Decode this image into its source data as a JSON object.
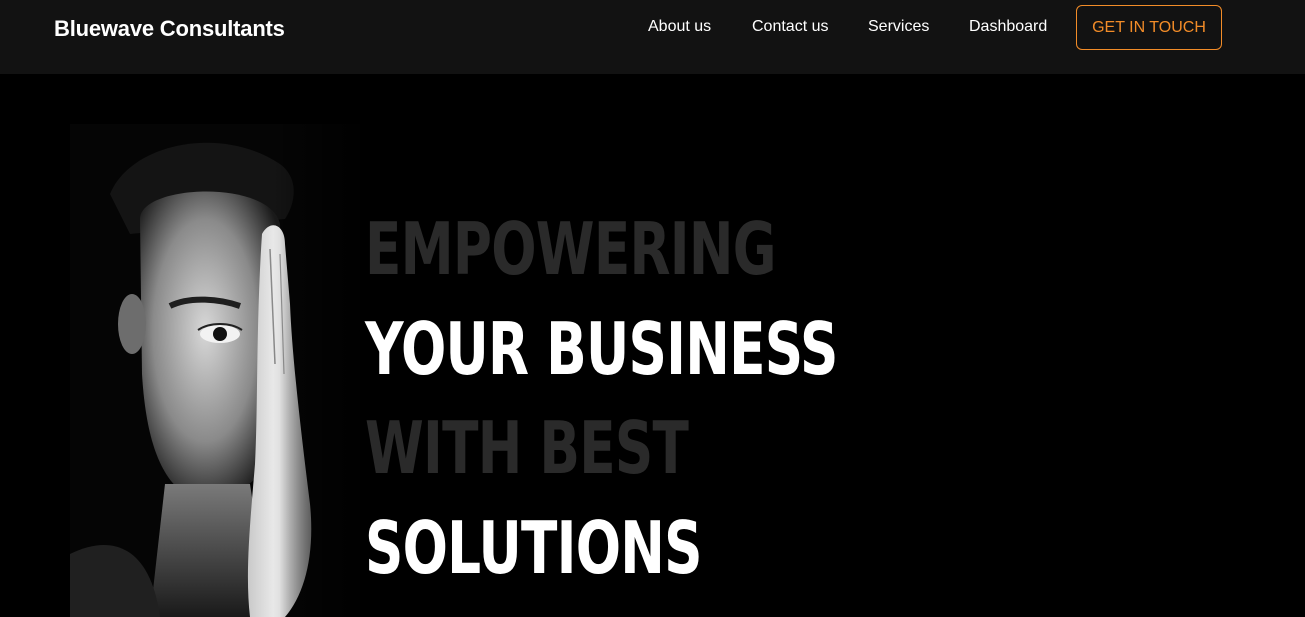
{
  "header": {
    "brand": "Bluewave Consultants",
    "nav": [
      "About us",
      "Contact us",
      "Services",
      "Dashboard"
    ],
    "cta_label": "GET IN TOUCH",
    "cta_color": "#f28c28",
    "background": "#121212"
  },
  "hero": {
    "headline_lines": [
      "EMPOWERING",
      "YOUR BUSINESS",
      "WITH BEST",
      "SOLUTIONS"
    ],
    "dim_color": "#2a2a2a",
    "bright_color": "#ffffff",
    "photo": "portrait-hand-covering-eye"
  }
}
